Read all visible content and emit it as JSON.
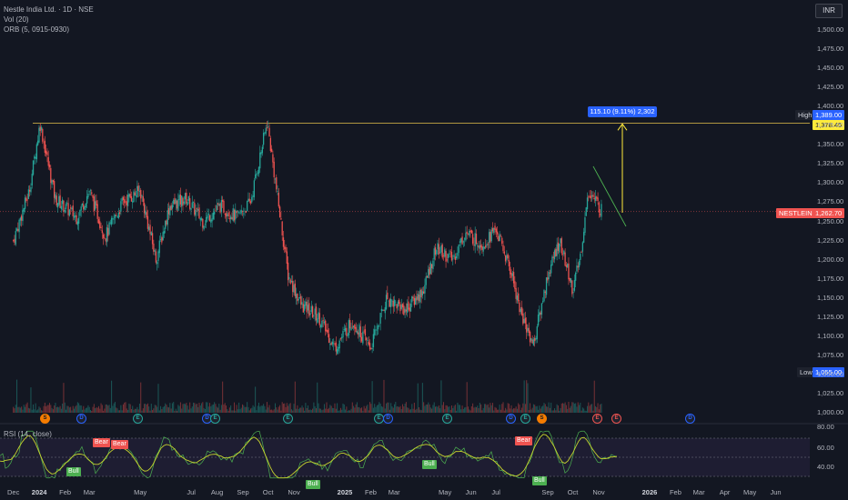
{
  "header": {
    "symbol_line": "Nestle India Ltd. · 1D · NSE",
    "vol_line": "Vol (20)",
    "orb_line": "ORB (5, 0915-0930)",
    "currency": "INR"
  },
  "price_tags": {
    "high_label": "High",
    "high_value": "1,389.00",
    "level_value": "1,378.45",
    "symbol_tag": "NESTLEIND",
    "last_value": "1,262.70",
    "low_label": "Low",
    "low_value": "1,055.00"
  },
  "measure_label": "115.10 (9.11%) 2,302",
  "rsi": {
    "label": "RSI (14, close)",
    "ticks": [
      "80.00",
      "60.00",
      "40.00"
    ]
  },
  "signals": {
    "bull": "Bull",
    "bear": "Bear"
  },
  "events": [
    "S",
    "D",
    "E",
    "D",
    "E",
    "E",
    "E",
    "D",
    "E",
    "D",
    "E",
    "S",
    "E",
    "E",
    "D",
    "E",
    "E"
  ],
  "colors": {
    "up": "#26a69a",
    "down": "#ef5350",
    "level_line": "#e5c24a",
    "accent": "#2962ff",
    "rsi_line": "#c7d32e",
    "rsi_fast": "#4caf50"
  },
  "chart_data": {
    "type": "line",
    "series": [
      {
        "name": "NESTLEIND close",
        "points": [
          [
            "2023-12-01",
            1225
          ],
          [
            "2023-12-20",
            1290
          ],
          [
            "2024-01-02",
            1378
          ],
          [
            "2024-01-20",
            1280
          ],
          [
            "2024-02-15",
            1255
          ],
          [
            "2024-03-01",
            1290
          ],
          [
            "2024-03-20",
            1230
          ],
          [
            "2024-04-10",
            1275
          ],
          [
            "2024-05-01",
            1290
          ],
          [
            "2024-05-20",
            1200
          ],
          [
            "2024-06-05",
            1270
          ],
          [
            "2024-06-25",
            1280
          ],
          [
            "2024-07-15",
            1250
          ],
          [
            "2024-08-05",
            1270
          ],
          [
            "2024-08-25",
            1255
          ],
          [
            "2024-09-10",
            1275
          ],
          [
            "2024-09-30",
            1380
          ],
          [
            "2024-10-10",
            1300
          ],
          [
            "2024-10-25",
            1180
          ],
          [
            "2024-11-10",
            1140
          ],
          [
            "2024-12-01",
            1125
          ],
          [
            "2024-12-20",
            1085
          ],
          [
            "2025-01-10",
            1120
          ],
          [
            "2025-02-01",
            1085
          ],
          [
            "2025-02-20",
            1150
          ],
          [
            "2025-03-15",
            1135
          ],
          [
            "2025-04-05",
            1160
          ],
          [
            "2025-04-20",
            1215
          ],
          [
            "2025-05-10",
            1200
          ],
          [
            "2025-05-25",
            1235
          ],
          [
            "2025-06-15",
            1220
          ],
          [
            "2025-07-01",
            1240
          ],
          [
            "2025-07-20",
            1180
          ],
          [
            "2025-08-01",
            1125
          ],
          [
            "2025-08-15",
            1090
          ],
          [
            "2025-09-01",
            1180
          ],
          [
            "2025-09-15",
            1225
          ],
          [
            "2025-10-01",
            1160
          ],
          [
            "2025-10-10",
            1205
          ],
          [
            "2025-10-20",
            1290
          ],
          [
            "2025-11-05",
            1262.7
          ]
        ]
      }
    ],
    "horizontal_line": 1378.45,
    "measure": {
      "from": 1262.7,
      "to": 1378.45,
      "change": 115.1,
      "percent": 9.11,
      "bars": 2302
    },
    "yaxis": {
      "ticks": [
        1000,
        1025,
        1050,
        1075,
        1100,
        1125,
        1150,
        1175,
        1200,
        1225,
        1250,
        1275,
        1300,
        1325,
        1350,
        1375,
        1400,
        1425,
        1450,
        1475,
        1500
      ],
      "labels": [
        "1,000.00",
        "1,025.00",
        "1,050.00",
        "1,075.00",
        "1,100.00",
        "1,125.00",
        "1,150.00",
        "1,175.00",
        "1,200.00",
        "1,225.00",
        "1,250.00",
        "1,275.00",
        "1,300.00",
        "1,325.00",
        "1,350.00",
        "1,375.00",
        "1,400.00",
        "1,425.00",
        "1,450.00",
        "1,475.00",
        "1,500.00"
      ],
      "ylim": [
        1000,
        1500
      ]
    },
    "xaxis": {
      "labels": [
        "Dec",
        "2024",
        "Feb",
        "Mar",
        "May",
        "Jul",
        "Aug",
        "Sep",
        "Oct",
        "Nov",
        "2025",
        "Feb",
        "Mar",
        "May",
        "Jun",
        "Jul",
        "Sep",
        "Oct",
        "Nov",
        "2026",
        "Feb",
        "Mar",
        "Apr",
        "May",
        "Jun"
      ],
      "dates": [
        "2023-12-01",
        "2024-01-01",
        "2024-02-01",
        "2024-03-01",
        "2024-05-01",
        "2024-07-01",
        "2024-08-01",
        "2024-09-01",
        "2024-10-01",
        "2024-11-01",
        "2025-01-01",
        "2025-02-01",
        "2025-03-01",
        "2025-05-01",
        "2025-06-01",
        "2025-07-01",
        "2025-09-01",
        "2025-10-01",
        "2025-11-01",
        "2026-01-01",
        "2026-02-01",
        "2026-03-01",
        "2026-04-01",
        "2026-05-01",
        "2026-06-01"
      ],
      "bold": [
        "2024",
        "2025",
        "2026"
      ]
    },
    "grid": false
  }
}
